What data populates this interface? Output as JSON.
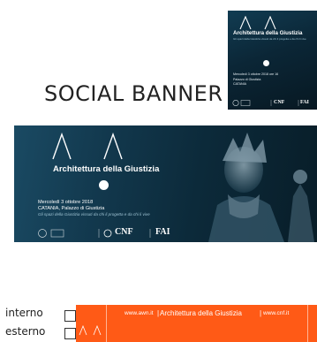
{
  "heading": "SOCIAL BANNER",
  "event": {
    "title": "Architettura della Giustizia",
    "date_line": "Mercoledì 3 ottobre 2018",
    "date_line_short": "Mercoledì 3 ottobre 2018 ore 16",
    "place_line": "CATANIA, Palazzo di Giustizia",
    "place_line_short_1": "Palazzo di Giustizia",
    "place_line_short_2": "CATANIA",
    "tagline": "Gli spazi della Giustizia vissuti da chi li progetta e da chi li vive",
    "logo_cnf": "CNF",
    "logo_fai": "FAI"
  },
  "rows": {
    "interno_label": "interno",
    "esterno_label": "esterno"
  },
  "strip": {
    "left_url": "www.awn.it",
    "title": "Architettura della Giustizia",
    "right_url": "www.cnf.it",
    "separator": "|"
  },
  "colors": {
    "accent": "#ff5a16",
    "banner_dark": "#0c2a3a"
  }
}
